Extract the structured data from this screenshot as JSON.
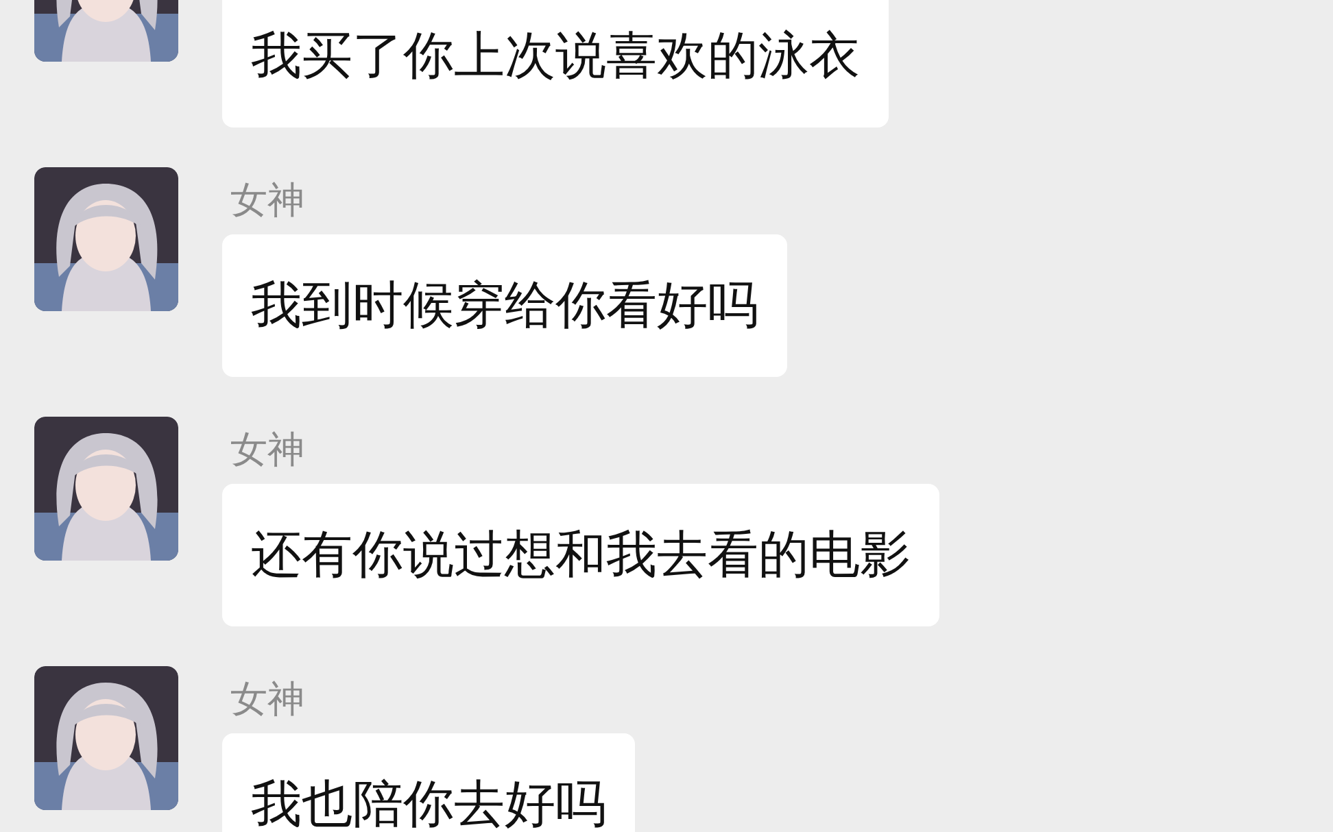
{
  "messages": [
    {
      "text": "我买了你上次说喜欢的泳衣"
    },
    {
      "sender": "女神",
      "text": "我到时候穿给你看好吗"
    },
    {
      "sender": "女神",
      "text": "还有你说过想和我去看的电影"
    },
    {
      "sender": "女神",
      "text": "我也陪你去好吗"
    }
  ]
}
